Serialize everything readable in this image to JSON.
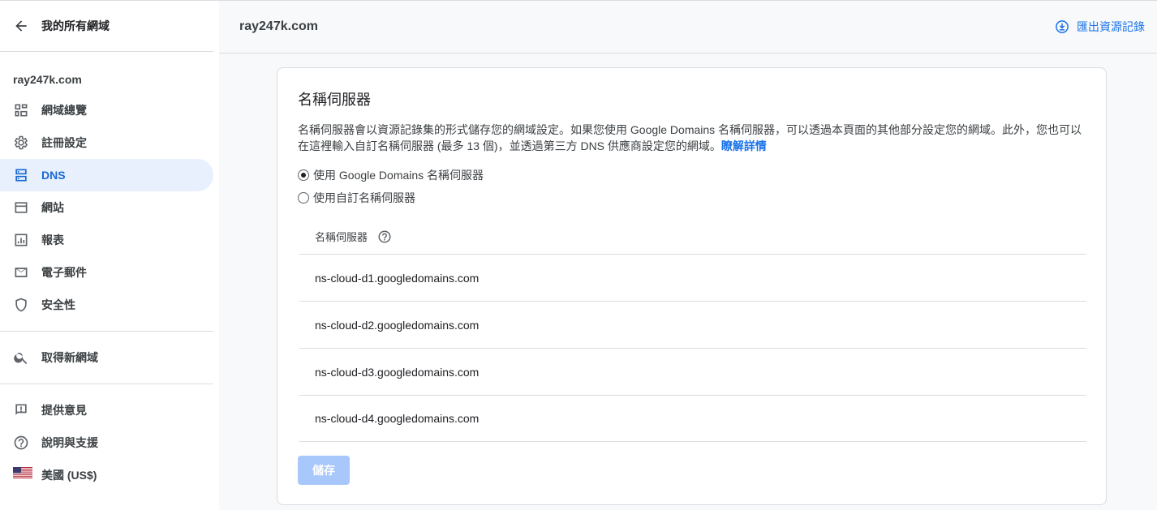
{
  "sidebar": {
    "back_label": "我的所有網域",
    "domain": "ray247k.com",
    "nav": [
      {
        "label": "網域總覽",
        "icon": "dashboard-icon"
      },
      {
        "label": "註冊設定",
        "icon": "gear-icon"
      },
      {
        "label": "DNS",
        "icon": "dns-icon",
        "active": true
      },
      {
        "label": "網站",
        "icon": "website-icon"
      },
      {
        "label": "報表",
        "icon": "chart-icon"
      },
      {
        "label": "電子郵件",
        "icon": "mail-icon"
      },
      {
        "label": "安全性",
        "icon": "shield-icon"
      }
    ],
    "search_label": "取得新網域",
    "footer": [
      {
        "label": "提供意見",
        "icon": "feedback-icon"
      },
      {
        "label": "說明與支援",
        "icon": "help-icon"
      },
      {
        "label": "美國 (US$)",
        "icon": "us-flag-icon"
      }
    ]
  },
  "header": {
    "title": "ray247k.com",
    "export_label": "匯出資源記錄"
  },
  "card": {
    "title": "名稱伺服器",
    "description": "名稱伺服器會以資源記錄集的形式儲存您的網域設定。如果您使用 Google Domains 名稱伺服器，可以透過本頁面的其他部分設定您的網域。此外，您也可以在這裡輸入自訂名稱伺服器 (最多 13 個)，並透過第三方 DNS 供應商設定您的網域。",
    "learn_more": "瞭解詳情",
    "options": [
      {
        "label": "使用 Google Domains 名稱伺服器",
        "checked": true
      },
      {
        "label": "使用自訂名稱伺服器",
        "checked": false
      }
    ],
    "ns_header": "名稱伺服器",
    "nameservers": [
      "ns-cloud-d1.googledomains.com",
      "ns-cloud-d2.googledomains.com",
      "ns-cloud-d3.googledomains.com",
      "ns-cloud-d4.googledomains.com"
    ],
    "save_label": "儲存"
  },
  "colors": {
    "accent": "#1a73e8",
    "active_bg": "#e8f0fe",
    "save_disabled": "#a8c7fa"
  }
}
